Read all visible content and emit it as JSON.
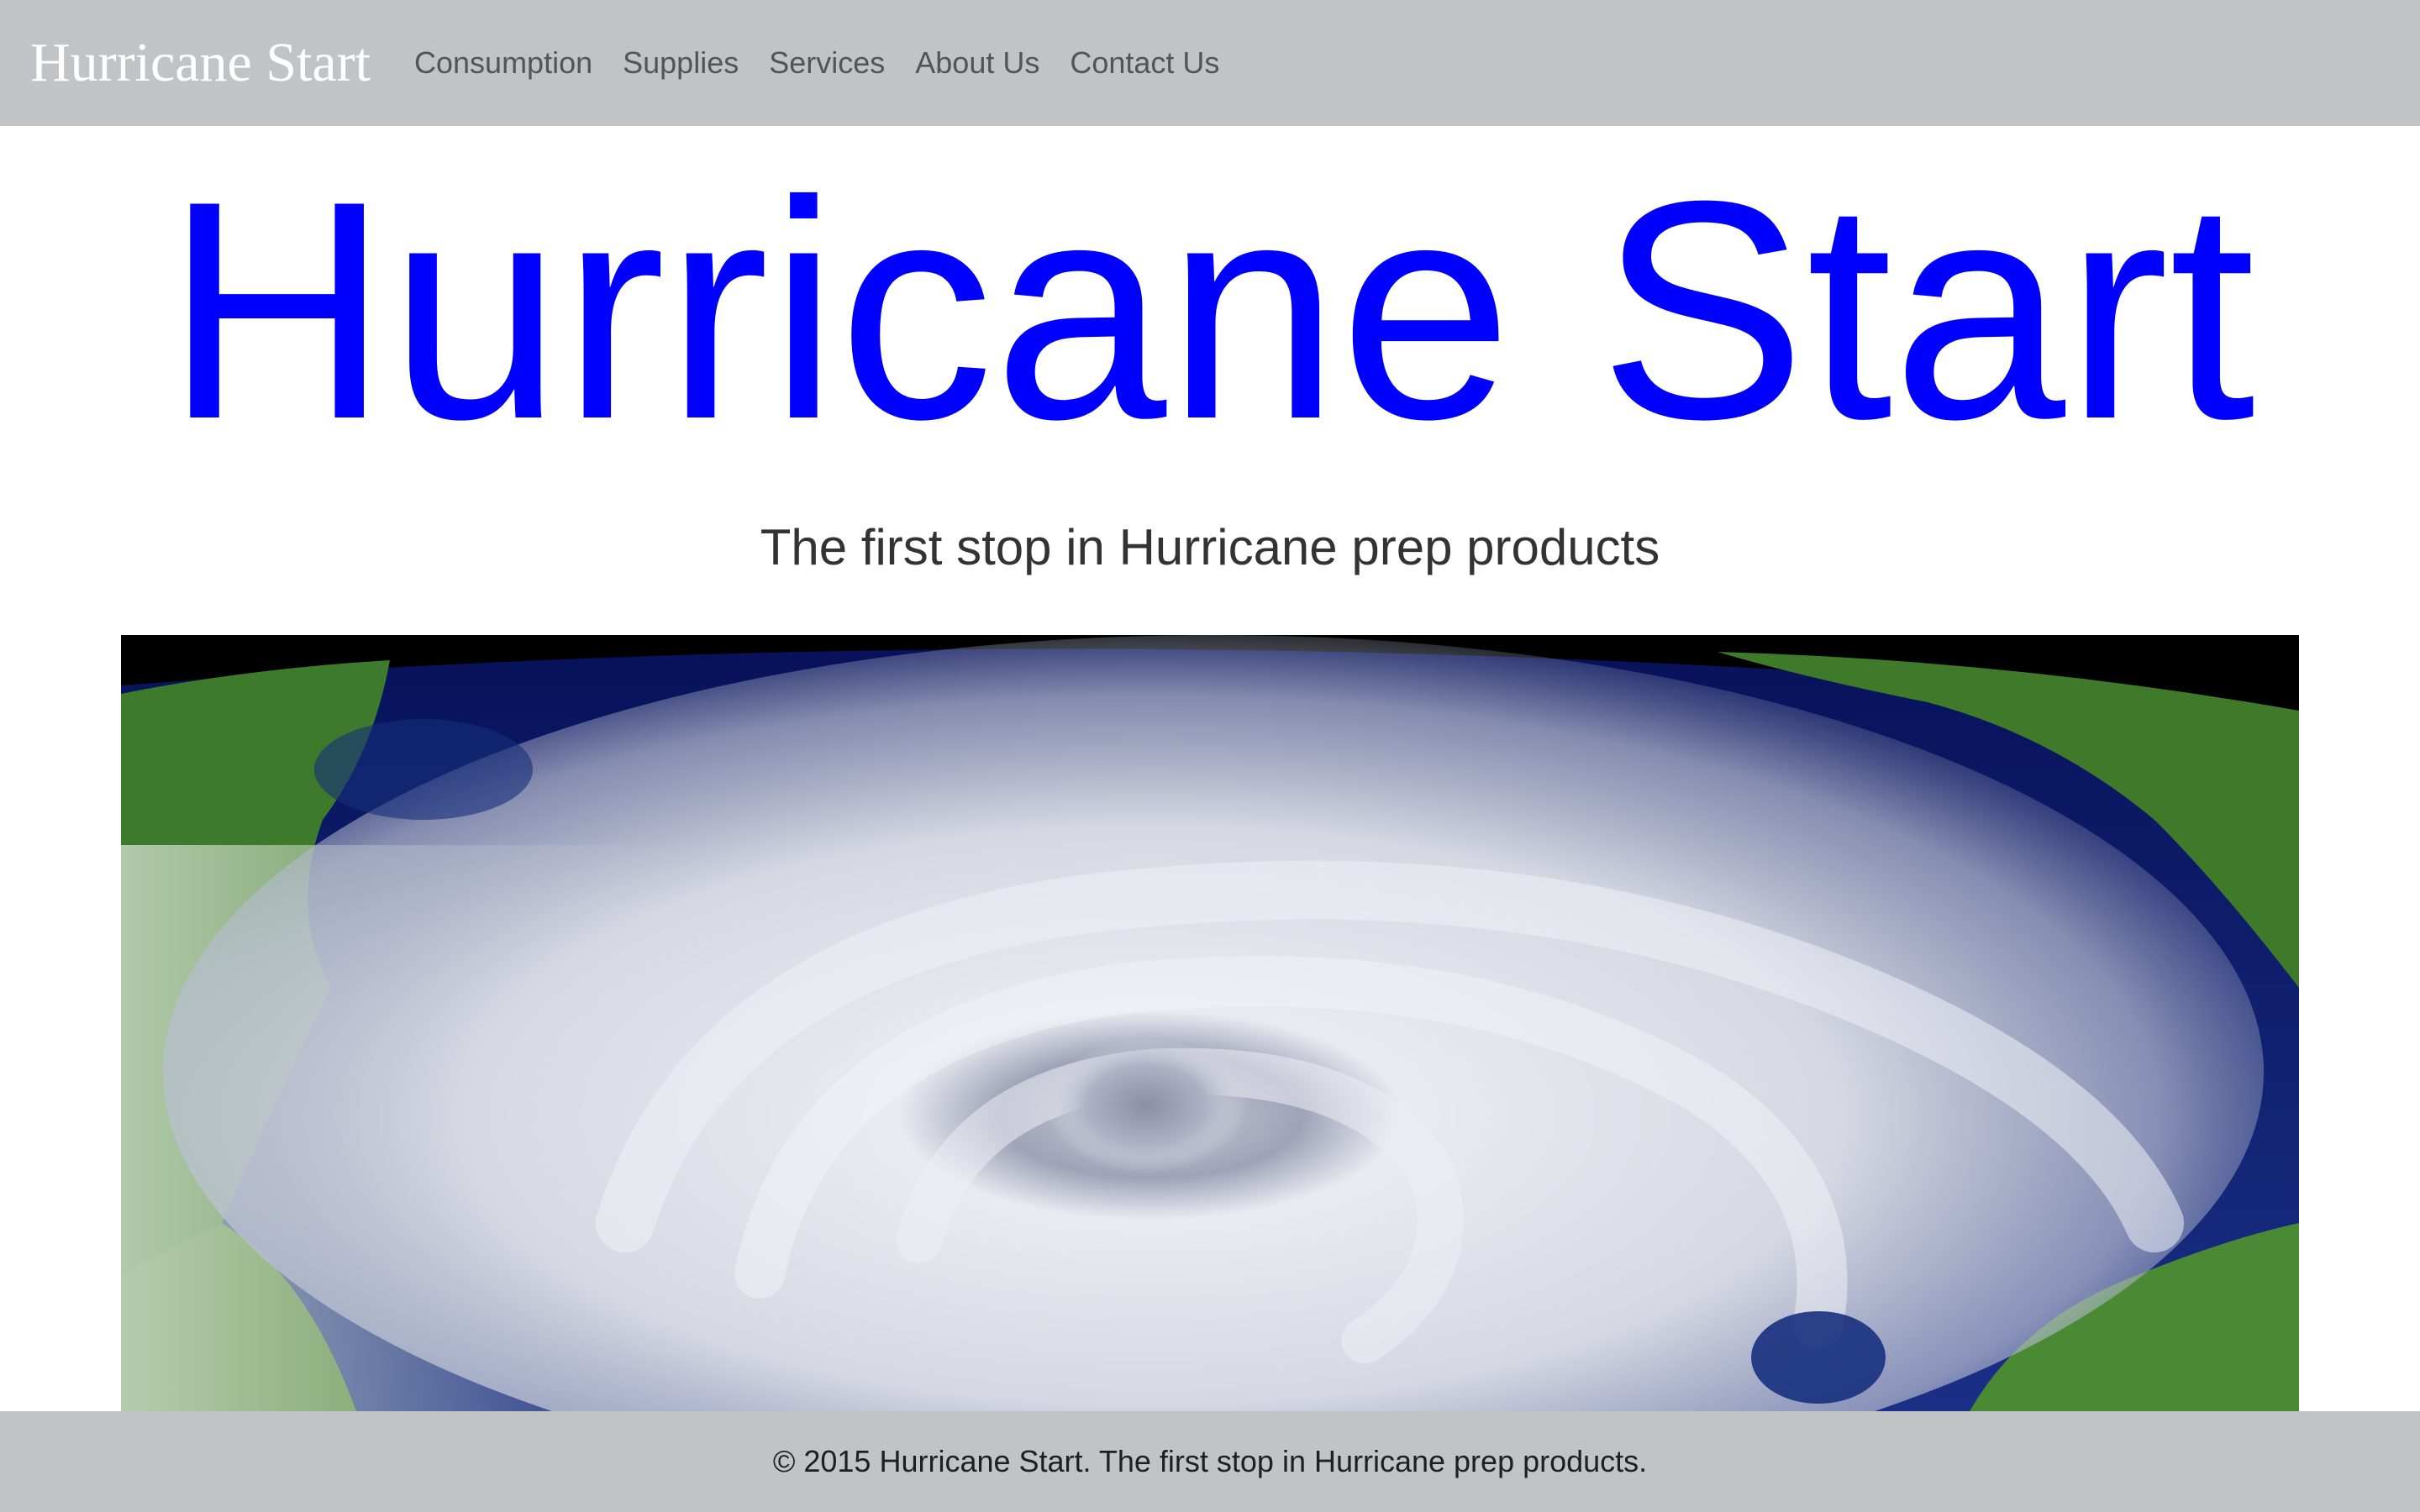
{
  "navbar": {
    "brand": "Hurricane Start",
    "links": [
      {
        "label": "Consumption"
      },
      {
        "label": "Supplies"
      },
      {
        "label": "Services"
      },
      {
        "label": "About Us"
      },
      {
        "label": "Contact Us"
      }
    ]
  },
  "hero": {
    "title": "Hurricane Start",
    "tagline": "The first stop in Hurricane prep products",
    "image": {
      "icon": "hurricane-satellite-image",
      "colors": {
        "ocean": "#0b1a6b",
        "land": "#3f7a2a",
        "cloud": "#e6e8ee",
        "space": "#000000"
      }
    }
  },
  "footer": {
    "text": "© 2015 Hurricane Start. The first stop in Hurricane prep products."
  },
  "colors": {
    "navbar_bg": "#c2c3c7",
    "title_color": "#0000ff",
    "nav_link_color": "#545454"
  }
}
